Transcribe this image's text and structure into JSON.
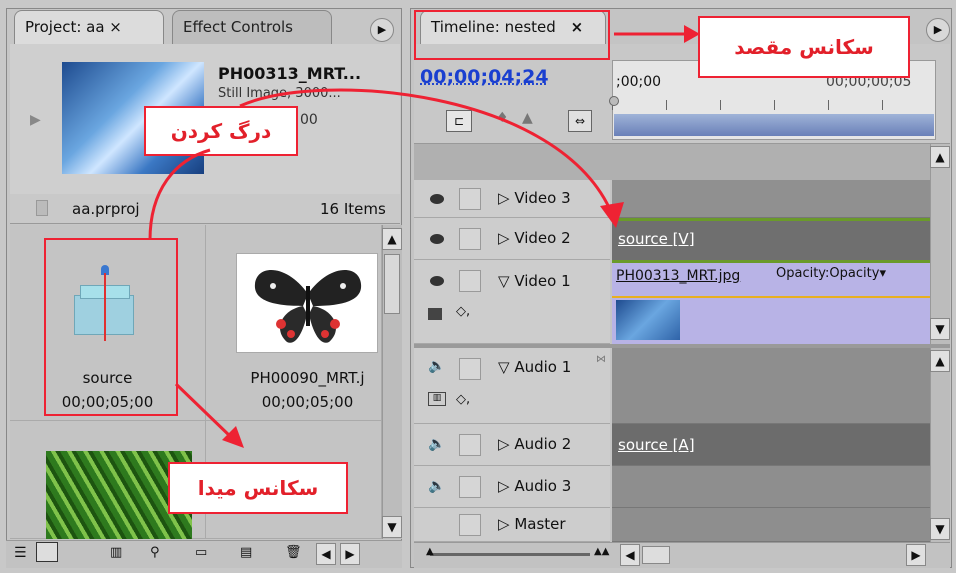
{
  "project_panel": {
    "tabs": [
      {
        "label": "Project: aa ×"
      },
      {
        "label": "Effect Controls"
      }
    ],
    "preview": {
      "title": "PH00313_MRT...",
      "line1": "Still Image, 3000...",
      "line2": "00"
    },
    "project_file": "aa.prproj",
    "item_count": "16 Items",
    "items": [
      {
        "name": "source",
        "duration": "00;00;05;00"
      },
      {
        "name": "PH00090_MRT.j",
        "duration": "00;00;05;00"
      }
    ]
  },
  "timeline_panel": {
    "tab_label": "Timeline: nested",
    "close": "×",
    "timecode": "00;00;04;24",
    "ruler_start": ";00;00",
    "ruler_end": "00;00;00;05",
    "tracks": [
      {
        "name": "Video 3"
      },
      {
        "name": "Video 2",
        "clip": "source [V]"
      },
      {
        "name": "Video 1",
        "clip": "PH00313_MRT.jpg",
        "clip_effect": "Opacity:Opacity"
      },
      {
        "name": "Audio 1"
      },
      {
        "name": "Audio 2",
        "clip": "source [A]"
      },
      {
        "name": "Audio 3"
      },
      {
        "name": "Master"
      }
    ]
  },
  "annotations": {
    "destination": "سکانس مقصد",
    "drag": "درگ کردن",
    "source": "سکانس میدا"
  },
  "colors": {
    "accent_red": "#e2202a",
    "timecode_blue": "#1a3fd0",
    "clip_purple": "#b8b3e6"
  }
}
